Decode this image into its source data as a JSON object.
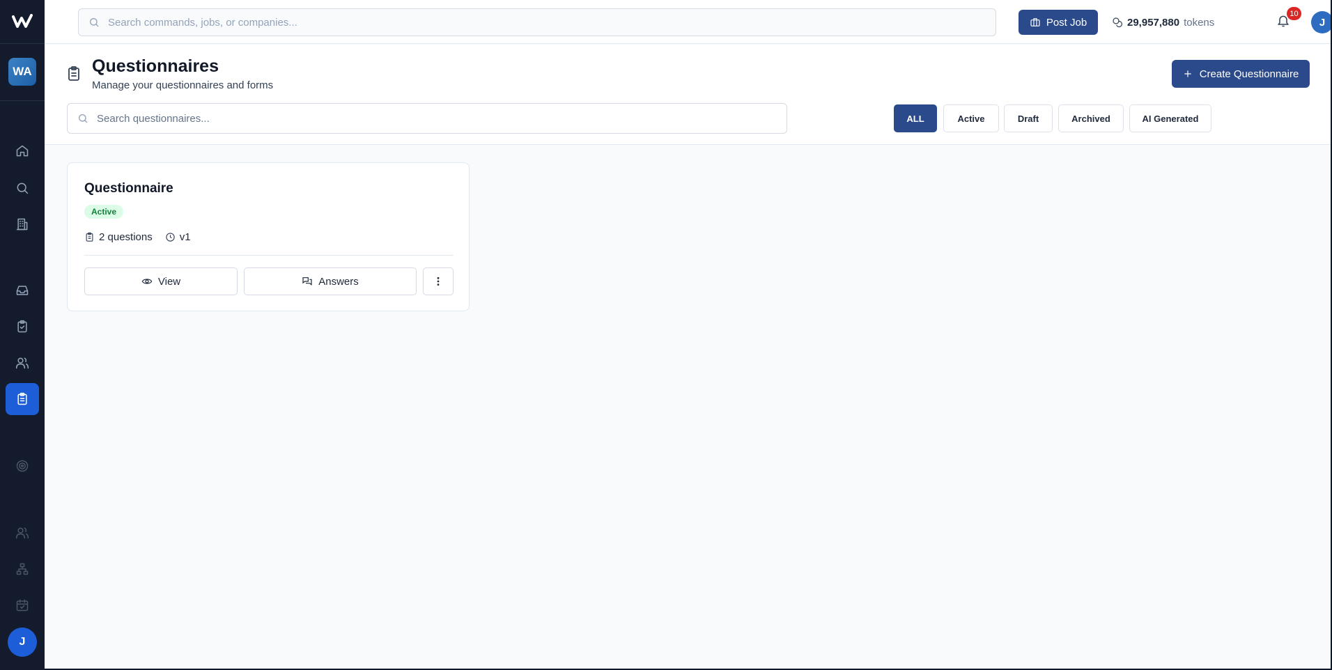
{
  "topbar": {
    "search_placeholder": "Search commands, jobs, or companies...",
    "post_job_label": "Post Job",
    "tokens_value": "29,957,880",
    "tokens_unit": "tokens",
    "notification_count": "10",
    "user_initial": "J"
  },
  "sidebar": {
    "workspace_initials": "WA",
    "user_initial": "J",
    "items": [
      {
        "name": "home",
        "active": false
      },
      {
        "name": "search",
        "active": false
      },
      {
        "name": "companies",
        "active": false
      },
      {
        "name": "inbox",
        "active": false
      },
      {
        "name": "tasks",
        "active": false
      },
      {
        "name": "people",
        "active": false
      },
      {
        "name": "questionnaires",
        "active": true
      },
      {
        "name": "target",
        "active": false
      },
      {
        "name": "team",
        "active": false
      },
      {
        "name": "org-chart",
        "active": false
      },
      {
        "name": "calendar",
        "active": false
      }
    ]
  },
  "page": {
    "title": "Questionnaires",
    "subtitle": "Manage your questionnaires and forms",
    "create_label": "Create Questionnaire",
    "search_placeholder": "Search questionnaires...",
    "filters": [
      "ALL",
      "Active",
      "Draft",
      "Archived",
      "AI Generated"
    ],
    "active_filter": "ALL"
  },
  "card": {
    "title": "Questionnaire",
    "status": "Active",
    "questions": "2 questions",
    "version": "v1",
    "view_label": "View",
    "answers_label": "Answers"
  },
  "colors": {
    "sidebar_bg": "#141b2d",
    "primary": "#2b4a8b",
    "active_nav": "#1d5ed8",
    "badge_bg": "#dcfce7",
    "badge_text": "#15803d",
    "notification": "#dc2626"
  }
}
